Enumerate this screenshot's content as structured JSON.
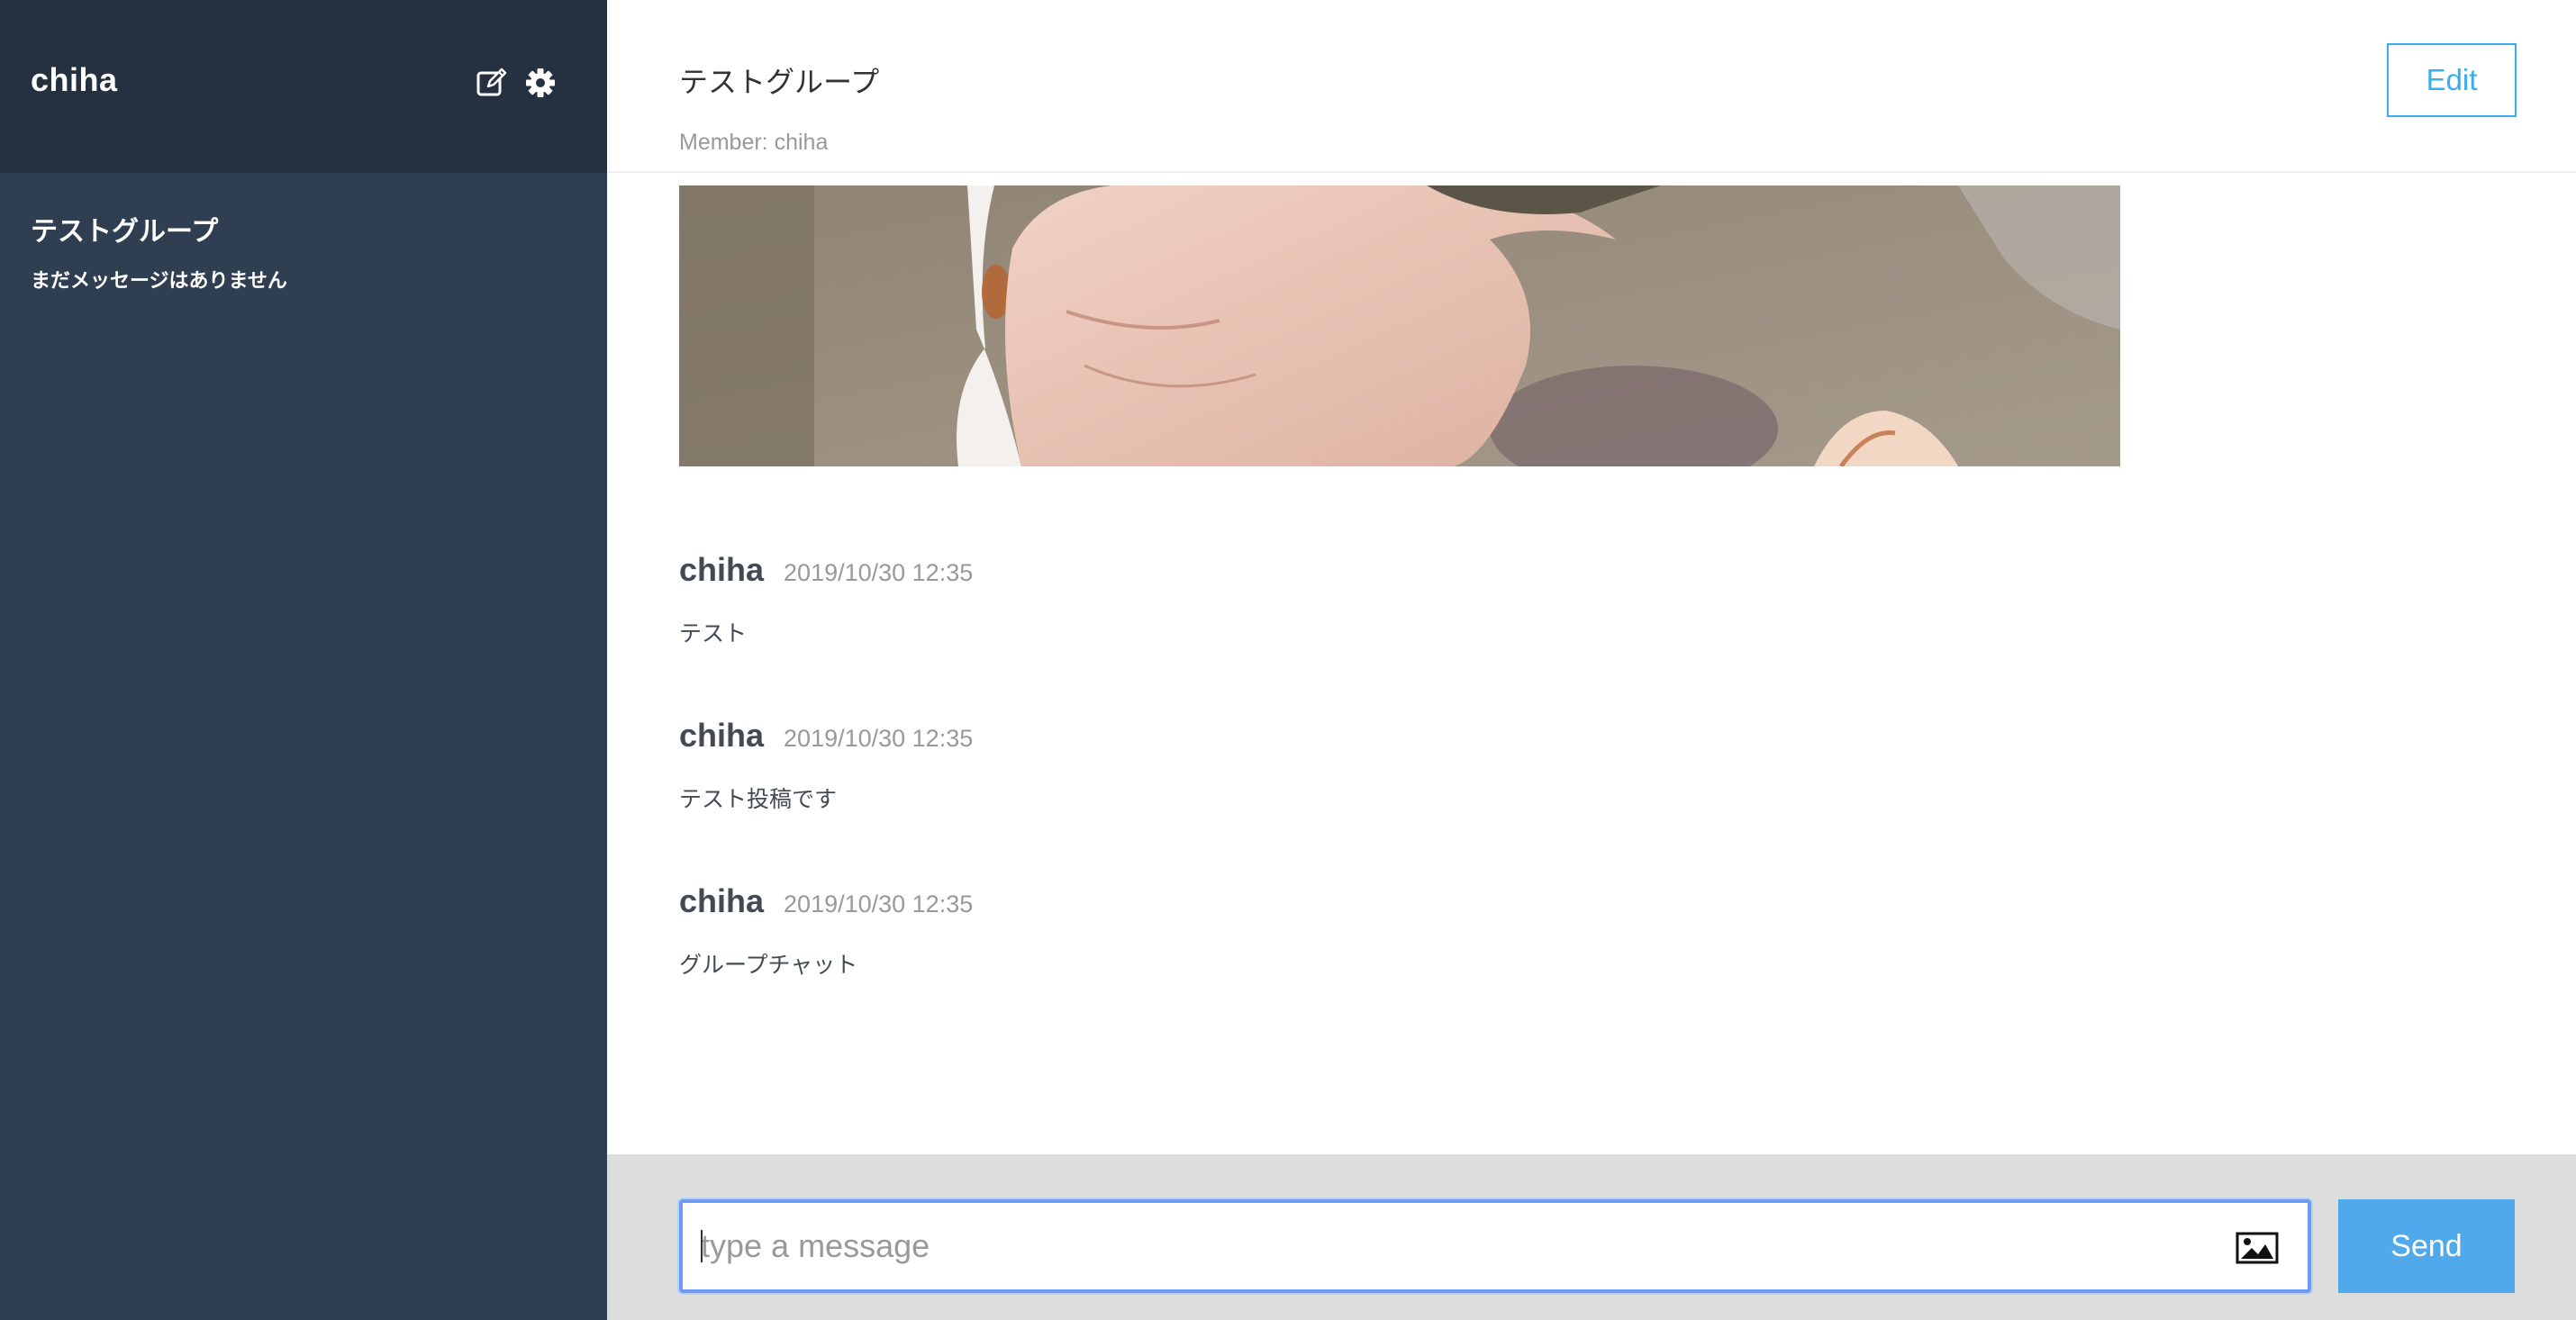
{
  "sidebar": {
    "user_name": "chiha",
    "icons": [
      "edit-icon",
      "gear-icon"
    ],
    "groups": [
      {
        "name": "テストグループ",
        "latest": "まだメッセージはありません"
      }
    ]
  },
  "main": {
    "group_title": "テストグループ",
    "members": "Member: chiha",
    "edit_label": "Edit",
    "messages": [
      {
        "user": "chiha",
        "date": "2019/10/30 12:35",
        "text": "テスト"
      },
      {
        "user": "chiha",
        "date": "2019/10/30 12:35",
        "text": "テスト投稿です"
      },
      {
        "user": "chiha",
        "date": "2019/10/30 12:35",
        "text": "グループチャット"
      }
    ]
  },
  "form": {
    "placeholder": "type a message",
    "image_icon": "image-icon",
    "send_label": "Send"
  },
  "colors": {
    "sidebar_bg": "#2f3e51",
    "sidebar_header_bg": "#253141",
    "accent": "#38aef0",
    "send_bg": "#4fa9ea",
    "form_bar_bg": "#dddddd"
  }
}
